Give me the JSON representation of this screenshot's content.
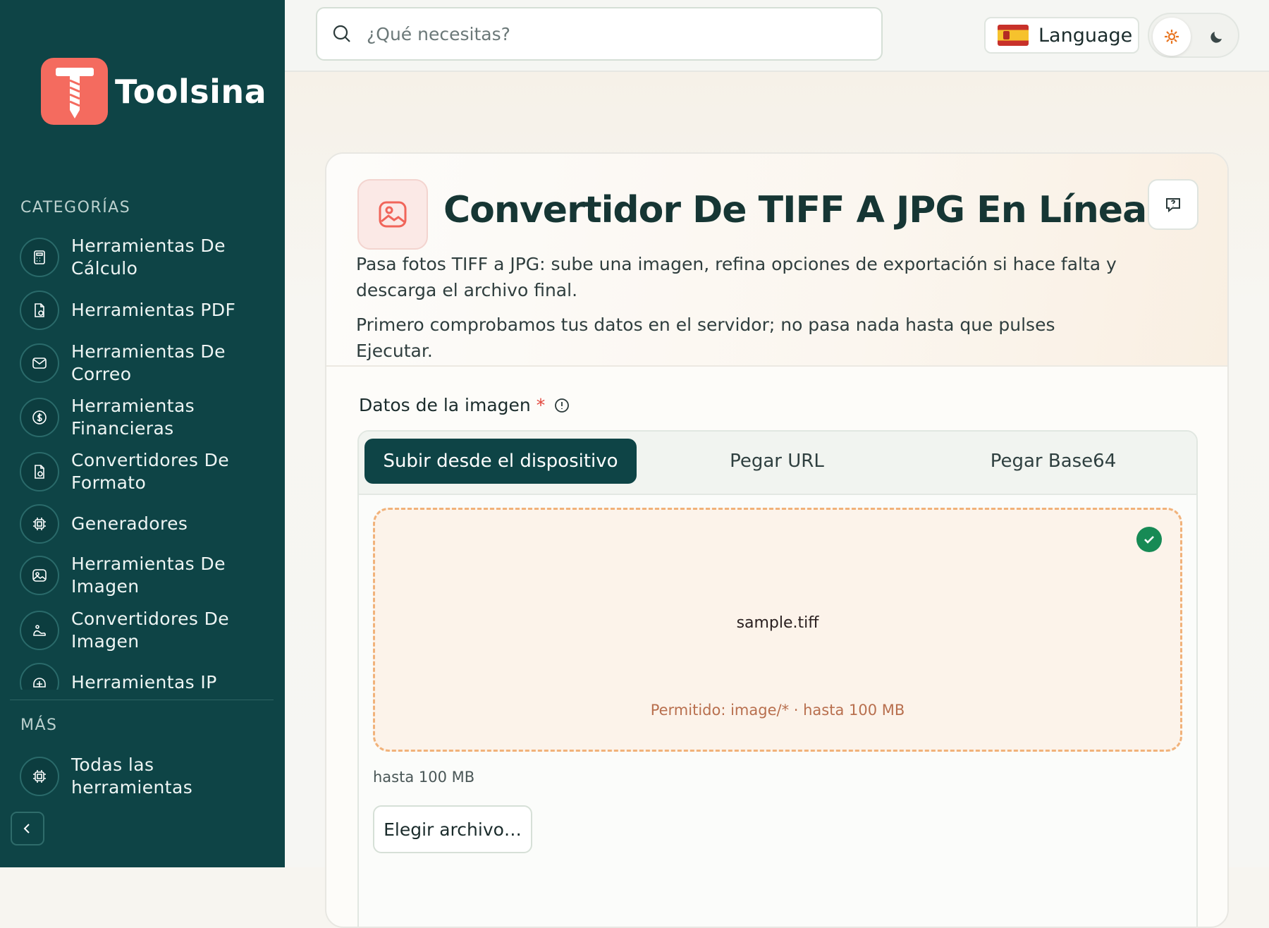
{
  "brand": {
    "name": "Toolsina",
    "accent": "#f46b5f",
    "sidebar_bg": "#0e4446"
  },
  "sidebar": {
    "categories_heading": "CATEGORÍAS",
    "categories": [
      {
        "label": "Herramientas De Cálculo",
        "icon": "calculator-icon"
      },
      {
        "label": "Herramientas PDF",
        "icon": "file-pdf-icon"
      },
      {
        "label": "Herramientas De Correo",
        "icon": "mail-icon"
      },
      {
        "label": "Herramientas Financieras",
        "icon": "dollar-icon"
      },
      {
        "label": "Convertidores De Formato",
        "icon": "file-convert-icon"
      },
      {
        "label": "Generadores",
        "icon": "cpu-icon"
      },
      {
        "label": "Herramientas De Imagen",
        "icon": "image-icon"
      },
      {
        "label": "Convertidores De Imagen",
        "icon": "image-convert-icon"
      },
      {
        "label": "Herramientas IP",
        "icon": "network-icon"
      }
    ],
    "more_heading": "MÁS",
    "more_items": [
      {
        "label": "Todas las herramientas",
        "icon": "cpu-icon"
      }
    ]
  },
  "topbar": {
    "search_placeholder": "¿Qué necesitas?",
    "language_label": "Language"
  },
  "tool": {
    "title": "Convertidor De TIFF A JPG En Línea",
    "description": "Pasa fotos TIFF a JPG: sube una imagen, refina opciones de exportación si hace falta y descarga el archivo final.",
    "note": "Primero comprobamos tus datos en el servidor; no pasa nada hasta que pulses Ejecutar."
  },
  "form": {
    "field_label": "Datos de la imagen",
    "required_mark": "*",
    "tabs": [
      "Subir desde el dispositivo",
      "Pegar URL",
      "Pegar Base64"
    ],
    "active_tab": 0,
    "file_name": "sample.tiff",
    "allowed_text": "Permitido: image/* · hasta 100 MB",
    "size_note": "hasta 100 MB",
    "choose_button": "Elegir archivo…"
  }
}
